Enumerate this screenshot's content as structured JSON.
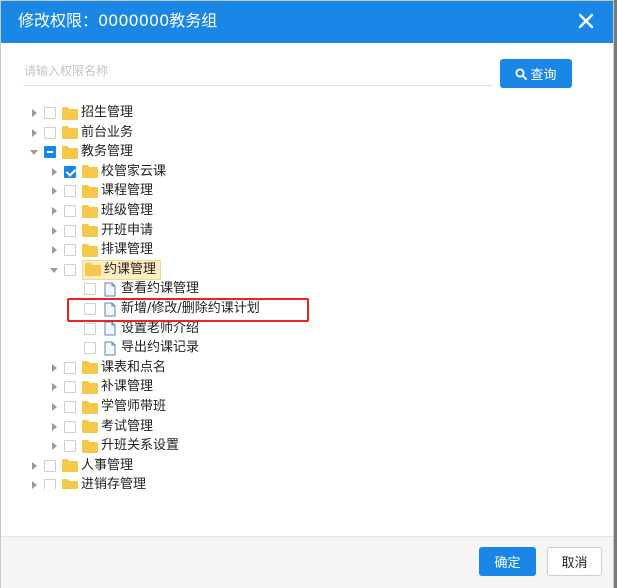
{
  "dialog": {
    "title": "修改权限：0000000教务组",
    "close_icon": "close-icon"
  },
  "search": {
    "placeholder": "请输入权限名称",
    "value": "",
    "button_label": "查询",
    "button_icon": "search-icon"
  },
  "tree": [
    {
      "label": "招生管理",
      "type": "folder",
      "level": 0,
      "expand": "collapsed",
      "check": "none"
    },
    {
      "label": "前台业务",
      "type": "folder",
      "level": 0,
      "expand": "collapsed",
      "check": "none"
    },
    {
      "label": "教务管理",
      "type": "folder",
      "level": 0,
      "expand": "expanded",
      "check": "partial"
    },
    {
      "label": "校管家云课",
      "type": "folder",
      "level": 1,
      "expand": "collapsed",
      "check": "checked"
    },
    {
      "label": "课程管理",
      "type": "folder",
      "level": 1,
      "expand": "collapsed",
      "check": "none"
    },
    {
      "label": "班级管理",
      "type": "folder",
      "level": 1,
      "expand": "collapsed",
      "check": "none"
    },
    {
      "label": "开班申请",
      "type": "folder",
      "level": 1,
      "expand": "collapsed",
      "check": "none"
    },
    {
      "label": "排课管理",
      "type": "folder",
      "level": 1,
      "expand": "collapsed",
      "check": "none"
    },
    {
      "label": "约课管理",
      "type": "folder",
      "level": 1,
      "expand": "expanded",
      "check": "none",
      "selected": true
    },
    {
      "label": "查看约课管理",
      "type": "doc",
      "level": 2,
      "expand": "leaf",
      "check": "none"
    },
    {
      "label": "新增/修改/删除约课计划",
      "type": "doc",
      "level": 2,
      "expand": "leaf",
      "check": "none"
    },
    {
      "label": "设置老师介绍",
      "type": "doc",
      "level": 2,
      "expand": "leaf",
      "check": "none"
    },
    {
      "label": "导出约课记录",
      "type": "doc",
      "level": 2,
      "expand": "leaf",
      "check": "none"
    },
    {
      "label": "课表和点名",
      "type": "folder",
      "level": 1,
      "expand": "collapsed",
      "check": "none"
    },
    {
      "label": "补课管理",
      "type": "folder",
      "level": 1,
      "expand": "collapsed",
      "check": "none"
    },
    {
      "label": "学管师带班",
      "type": "folder",
      "level": 1,
      "expand": "collapsed",
      "check": "none"
    },
    {
      "label": "考试管理",
      "type": "folder",
      "level": 1,
      "expand": "collapsed",
      "check": "none"
    },
    {
      "label": "升班关系设置",
      "type": "folder",
      "level": 1,
      "expand": "collapsed",
      "check": "none"
    },
    {
      "label": "人事管理",
      "type": "folder",
      "level": 0,
      "expand": "collapsed",
      "check": "none"
    },
    {
      "label": "进销存管理",
      "type": "folder",
      "level": 0,
      "expand": "collapsed",
      "check": "none"
    }
  ],
  "footer": {
    "ok_label": "确定",
    "cancel_label": "取消"
  },
  "colors": {
    "accent": "#1a87e6",
    "highlight": "#ee2222",
    "folder": "#f5c84a",
    "selected_bg": "#fdedc5"
  }
}
